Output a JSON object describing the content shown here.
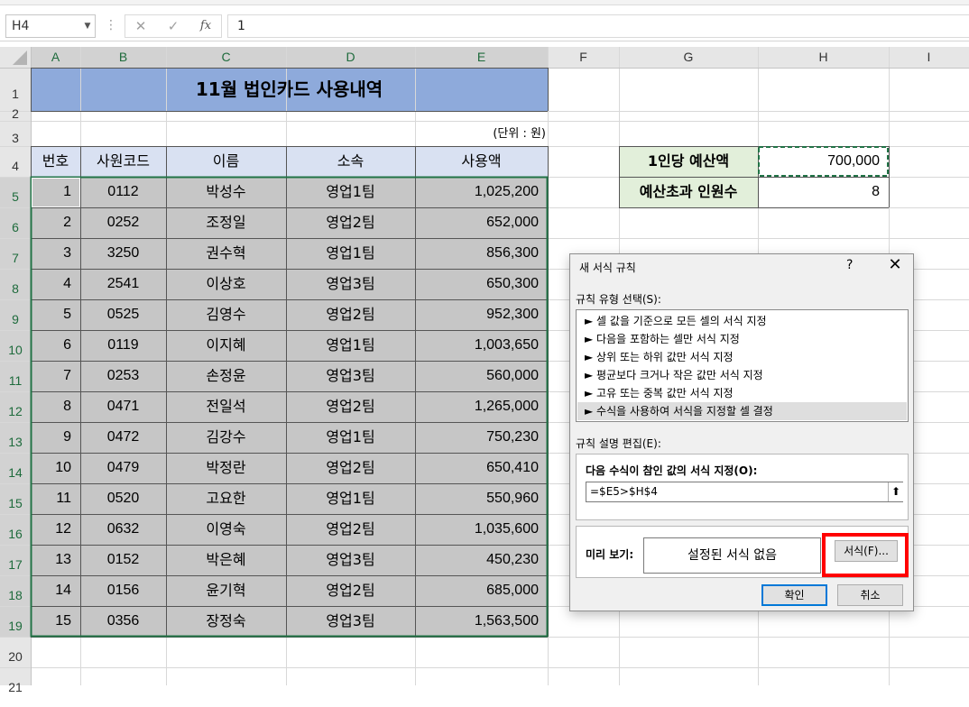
{
  "formula_bar": {
    "name_box": "H4",
    "cancel_icon": "✕",
    "enter_icon": "✓",
    "fx_icon": "fx",
    "formula": "1"
  },
  "columns": [
    "A",
    "B",
    "C",
    "D",
    "E",
    "F",
    "G",
    "H",
    "I"
  ],
  "rows": [
    "1",
    "2",
    "3",
    "4",
    "5",
    "6",
    "7",
    "8",
    "9",
    "10",
    "11",
    "12",
    "13",
    "14",
    "15",
    "16",
    "17",
    "18",
    "19",
    "20",
    "21"
  ],
  "sheet": {
    "title": "11월 법인카드 사용내역",
    "unit_note": "(단위 : 원)",
    "headers": [
      "번호",
      "사원코드",
      "이름",
      "소속",
      "사용액"
    ],
    "records": [
      [
        "1",
        "0112",
        "박성수",
        "영업1팀",
        "1,025,200"
      ],
      [
        "2",
        "0252",
        "조정일",
        "영업2팀",
        "652,000"
      ],
      [
        "3",
        "3250",
        "권수혁",
        "영업1팀",
        "856,300"
      ],
      [
        "4",
        "2541",
        "이상호",
        "영업3팀",
        "650,300"
      ],
      [
        "5",
        "0525",
        "김영수",
        "영업2팀",
        "952,300"
      ],
      [
        "6",
        "0119",
        "이지혜",
        "영업1팀",
        "1,003,650"
      ],
      [
        "7",
        "0253",
        "손정윤",
        "영업3팀",
        "560,000"
      ],
      [
        "8",
        "0471",
        "전일석",
        "영업2팀",
        "1,265,000"
      ],
      [
        "9",
        "0472",
        "김강수",
        "영업1팀",
        "750,230"
      ],
      [
        "10",
        "0479",
        "박정란",
        "영업2팀",
        "650,410"
      ],
      [
        "11",
        "0520",
        "고요한",
        "영업1팀",
        "550,960"
      ],
      [
        "12",
        "0632",
        "이영숙",
        "영업2팀",
        "1,035,600"
      ],
      [
        "13",
        "0152",
        "박은혜",
        "영업3팀",
        "450,230"
      ],
      [
        "14",
        "0156",
        "윤기혁",
        "영업2팀",
        "685,000"
      ],
      [
        "15",
        "0356",
        "장정숙",
        "영업3팀",
        "1,563,500"
      ]
    ],
    "budget_label": "1인당 예산액",
    "budget_value": "700,000",
    "over_label": "예산초과 인원수",
    "over_value": "8"
  },
  "dialog": {
    "title": "새 서식 규칙",
    "help": "?",
    "close": "✕",
    "rule_type_label": "규칙 유형 선택(S):",
    "rule_types": [
      "► 셀 값을 기준으로 모든 셀의 서식 지정",
      "► 다음을 포함하는 셀만 서식 지정",
      "► 상위 또는 하위 값만 서식 지정",
      "► 평균보다 크거나 작은 값만 서식 지정",
      "► 고유 또는 중복 값만 서식 지정",
      "► 수식을 사용하여 서식을 지정할 셀 결정"
    ],
    "edit_label": "규칙 설명 편집(E):",
    "formula_label": "다음 수식이 참인 값의 서식 지정(O):",
    "formula_value": "=$E5>$H$4",
    "collapse_icon": "⬆",
    "preview_label": "미리 보기:",
    "preview_text": "설정된 서식 없음",
    "format_button": "서식(F)...",
    "ok_button": "확인",
    "cancel_button": "취소"
  },
  "colors": {
    "title_fill": "#8eaadb",
    "header_fill": "#d9e1f2",
    "selected_fill": "#c6c6c6",
    "label_fill": "#e2efda",
    "selection_border": "#217346",
    "highlight": "#ff0000"
  }
}
